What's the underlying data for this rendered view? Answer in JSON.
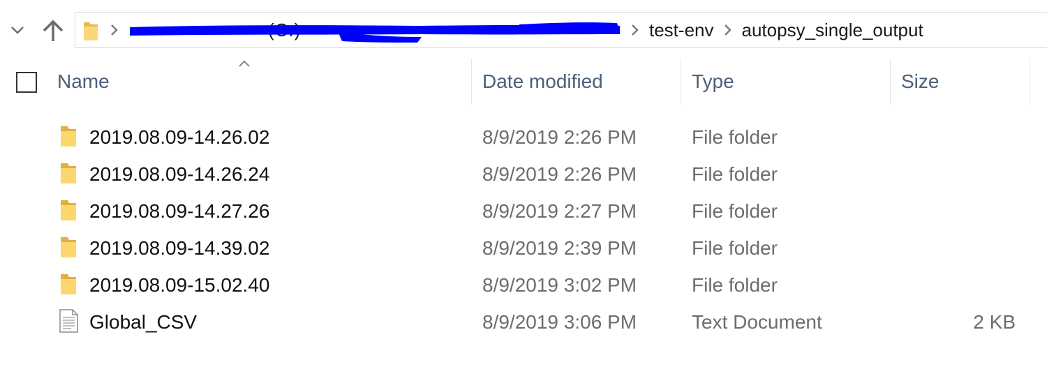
{
  "navigation": {
    "recent_icon": "chevron-down-icon",
    "up_icon": "arrow-up-icon"
  },
  "address_bar": {
    "folder_icon": "folder-icon",
    "redacted_crumb_fragments": "(C:)",
    "redaction_color": "#0000ff",
    "breadcrumbs": [
      "test-env",
      "autopsy_single_output"
    ]
  },
  "columns": {
    "name": "Name",
    "date_modified": "Date modified",
    "type": "Type",
    "size": "Size",
    "sort_indicator": "ascending"
  },
  "rows": [
    {
      "name": "2019.08.09-14.26.02",
      "date": "8/9/2019 2:26 PM",
      "type": "File folder",
      "size": "",
      "icon": "folder-icon"
    },
    {
      "name": "2019.08.09-14.26.24",
      "date": "8/9/2019 2:26 PM",
      "type": "File folder",
      "size": "",
      "icon": "folder-icon"
    },
    {
      "name": "2019.08.09-14.27.26",
      "date": "8/9/2019 2:27 PM",
      "type": "File folder",
      "size": "",
      "icon": "folder-icon"
    },
    {
      "name": "2019.08.09-14.39.02",
      "date": "8/9/2019 2:39 PM",
      "type": "File folder",
      "size": "",
      "icon": "folder-icon"
    },
    {
      "name": "2019.08.09-15.02.40",
      "date": "8/9/2019 3:02 PM",
      "type": "File folder",
      "size": "",
      "icon": "folder-icon"
    },
    {
      "name": "Global_CSV",
      "date": "8/9/2019 3:06 PM",
      "type": "Text Document",
      "size": "2 KB",
      "icon": "text-document-icon"
    }
  ],
  "colors": {
    "folder": "#f5c542",
    "header_text": "#4c607a",
    "secondary_text": "#6d6d6d"
  }
}
